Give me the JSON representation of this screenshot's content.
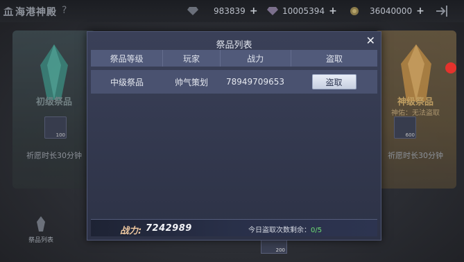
{
  "header": {
    "title": "海港神殿",
    "help": "?",
    "resources": [
      {
        "icon": "diamond-icon",
        "value": "983839",
        "plus": "+"
      },
      {
        "icon": "crystal-icon",
        "value": "10005394",
        "plus": "+"
      },
      {
        "icon": "gold-coin-icon",
        "value": "36040000",
        "plus": "+"
      }
    ]
  },
  "cards": {
    "left": {
      "name": "初级祭品",
      "chest_count": "100",
      "time": "祈愿时长30分钟"
    },
    "right": {
      "name": "神级祭品",
      "note": "神佑：无法盗取",
      "chest_count": "600",
      "time": "祈愿时长30分钟"
    }
  },
  "bottom": {
    "list_button": "祭品列表",
    "chest_count": "200"
  },
  "modal": {
    "title": "祭品列表",
    "close": "✕",
    "columns": [
      "祭品等级",
      "玩家",
      "战力",
      "盗取"
    ],
    "rows": [
      {
        "level": "中级祭品",
        "player": "帅气策划",
        "power": "78949709653",
        "action": "盗取"
      }
    ],
    "footer": {
      "power_label": "战力:",
      "power_value": "7242989",
      "attempts_label": "今日盗取次数剩余：",
      "attempts_value": "0/5"
    }
  },
  "colors": {
    "accent": "#6ede74",
    "badge": "#e5322c"
  }
}
